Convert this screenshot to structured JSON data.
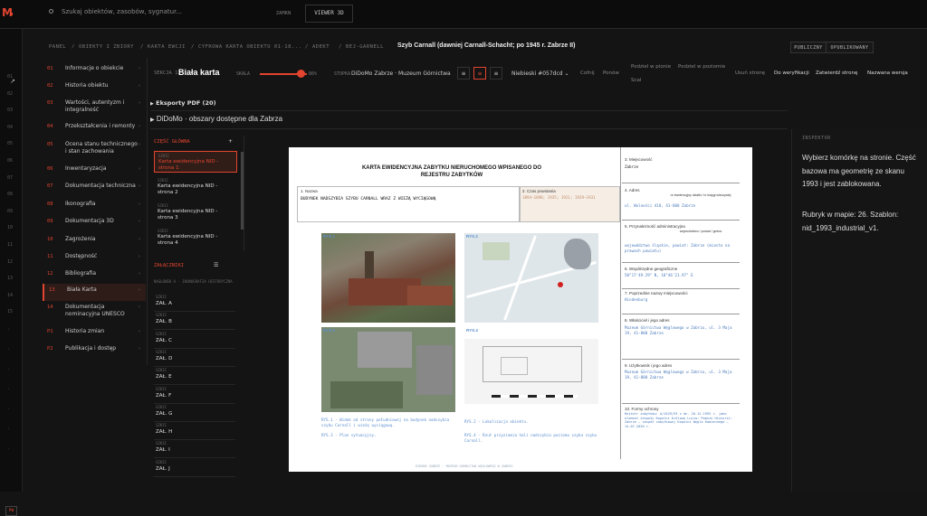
{
  "app": {
    "logo": "M",
    "search_placeholder": "Szukaj obiektów, zasobów, sygnatur...",
    "btn_zamk": "ZAMKN",
    "btn_viewer": "VIEWER 3D"
  },
  "rail": {
    "numbers": [
      "01",
      "02",
      "03",
      "04",
      "05",
      "06",
      "07",
      "08",
      "09",
      "10",
      "11",
      "12",
      "13",
      "14",
      "15"
    ],
    "foot": "PW"
  },
  "breadcrumb": [
    "PANEL",
    "OBIEKTY I ZBIORY",
    "KARTA EWCJI",
    "CYFROWA KARTA OBIEKTU 01-18...",
    "ADEKT",
    "BEJ-GARNELL"
  ],
  "breadcrumb_title": "Szyb Carnall (dawniej Carnall-Schacht; po 1945 r. Zabrze II)",
  "status_pills": [
    "PUBLICZNY",
    "OPUBLIKOWANY"
  ],
  "sections": [
    {
      "num": "01",
      "label": "Informacje o obiekcie"
    },
    {
      "num": "02",
      "label": "Historia obiektu"
    },
    {
      "num": "03",
      "label": "Wartości, autentyzm i integralność"
    },
    {
      "num": "04",
      "label": "Przekształcenia i remonty"
    },
    {
      "num": "05",
      "label": "Ocena stanu technicznego i stan zachowania"
    },
    {
      "num": "06",
      "label": "Inwentaryzacja"
    },
    {
      "num": "07",
      "label": "Dokumentacja techniczna"
    },
    {
      "num": "08",
      "label": "Ikonografia"
    },
    {
      "num": "09",
      "label": "Dokumentacja 3D"
    },
    {
      "num": "10",
      "label": "Zagrożenia"
    },
    {
      "num": "11",
      "label": "Dostępność"
    },
    {
      "num": "12",
      "label": "Bibliografia"
    },
    {
      "num": "13",
      "label": "Biała Karta"
    },
    {
      "num": "14",
      "label": "Dokumentacja nominacyjna UNESCO"
    },
    {
      "num": "P1",
      "label": "Historia zmian"
    },
    {
      "num": "P2",
      "label": "Publikacja i dostęp"
    }
  ],
  "toolbar": {
    "label": "SEKCJA 13",
    "title": "Biała karta",
    "scale_label": "SKALA",
    "scale_value": "86%",
    "scale_fraction": 0.86,
    "stopka_label": "STOPKA",
    "museum": "DiDoMo Zabrze · Muzeum Górnictwa Węglowego",
    "color": "Niebieski #057dcd",
    "actions": [
      "Cofnij",
      "Ponów",
      "Podziel w pionie",
      "Podziel w poziomie",
      "Scal",
      "Usuń stronę"
    ],
    "buttons": [
      "Do weryfikacji",
      "Zatwierdź stronę",
      "Nazwana wersja"
    ]
  },
  "accordion": {
    "pdf": "Eksporty PDF (20)",
    "didomo": "DiDoMo · obszary dostępne dla Zabrza"
  },
  "pages": {
    "header": "CZĘŚĆ GŁÓWNA",
    "items": [
      {
        "key": "SZKIC",
        "label": "Karta ewidencyjna NID - strona 1"
      },
      {
        "key": "SZKIC",
        "label": "Karta ewidencyjna NID - strona 2"
      },
      {
        "key": "SZKIC",
        "label": "Karta ewidencyjna NID - strona 3"
      },
      {
        "key": "SZKIC",
        "label": "Karta ewidencyjna NID - strona 4"
      }
    ]
  },
  "attachments": {
    "header": "ZAŁĄCZNIKI",
    "group": "NAGŁÓWEK A · IKONOGRAFIA HISTORYCZNA",
    "items": [
      {
        "key": "SZKIC",
        "label": "ZAŁ. A"
      },
      {
        "key": "SZKIC",
        "label": "ZAŁ. B"
      },
      {
        "key": "SZKIC",
        "label": "ZAŁ. C"
      },
      {
        "key": "SZKIC",
        "label": "ZAŁ. D"
      },
      {
        "key": "SZKIC",
        "label": "ZAŁ. E"
      },
      {
        "key": "SZKIC",
        "label": "ZAŁ. F"
      },
      {
        "key": "SZKIC",
        "label": "ZAŁ. G"
      },
      {
        "key": "SZKIC",
        "label": "ZAŁ. H"
      },
      {
        "key": "SZKIC",
        "label": "ZAŁ. I"
      },
      {
        "key": "SZKIC",
        "label": "ZAŁ. J"
      }
    ]
  },
  "inspector": {
    "header": "INSPEKTOR",
    "message": "Wybierz komórkę na stronie. Część bazowa ma geometrię ze skanu 1993 i jest zablokowana.",
    "info": "Rubryk w mapie: 26. Szablon: nid_1993_industrial_v1."
  },
  "document": {
    "title": "KARTA EWIDENCYJNA ZABYTKU NIERUCHOMEGO WPISANEGO DO REJESTRU ZABYTKÓW",
    "f1_label": "1. Nazwa",
    "f1_value": "BUDYNEK NADSZYBIA SZYBU CARNALL WRAZ Z WIEŻĄ WYCIĄGOWĄ",
    "f2_label": "2. Czas powstania",
    "f2_value": "1894–1898; 1935; 1921; 1929–1931",
    "f3_label": "3. Miejscowość",
    "f3_value": "Zabrze",
    "f4_label": "4. Adres",
    "f4_sub": "nr ewidencyjny działki / nr księgi wieczystej",
    "f4_value": "ul. Wolności 410, 41-800 Zabrze",
    "f5_label": "5. Przynależność administracyjna",
    "f5_sub": "województwo / powiat / gmina",
    "f5_value": "województwo śląskie, powiat: Zabrze (miasto na prawach powiatu)",
    "f6_label": "6. Współrzędne geograficzne",
    "f6_value": "50°17'49.29\" N, 18°46'21.97\" E",
    "f7_label": "7. Poprzednie nazwy miejscowości",
    "f7_value": "Hindenburg",
    "f8_label": "8. Właściciel i jego adres",
    "f8_value": "Muzeum Górnictwa Węglowego w Zabrzu, ul. 3 Maja 19, 41-800 Zabrze",
    "f9_label": "9. Użytkownik i jego adres",
    "f9_value": "Muzeum Górnictwa Węglowego w Zabrzu, ul. 3 Maja 19, 41-800 Zabrze",
    "f10_label": "10. Formy ochrony",
    "f10_value": "Rejestr zabytków: A/1629/93 z dn. 20.12.1993 r. jako element zespołu Kopalni Królowa Luiza; Pomnik Historii: Zabrze – zespół zabytkowej Kopalni Węgla Kamiennego – 14.07.2020 r.",
    "rys1_tag": "RYS.1",
    "rys2_tag": "RYS.2",
    "rys3_tag": "RYS.3",
    "rys4_tag": "RYS.4",
    "cap1": "RYS.1 - Widok od strony południowej na budynek nadszybia szybu Carnall i wieżę wyciągową.",
    "cap3": "RYS.3 - Plan sytuacyjny.",
    "cap2": "RYS.2 - Lokalizacja obiektu.",
    "cap4": "RYS.4 - Rzut przyziemia hali nadszybia poziomu szybu szybu Carnall.",
    "footer": "DIDOMO ZABRZE · MUZEUM GÓRNICTWA WĘGLOWEGO W ZABRZU"
  }
}
